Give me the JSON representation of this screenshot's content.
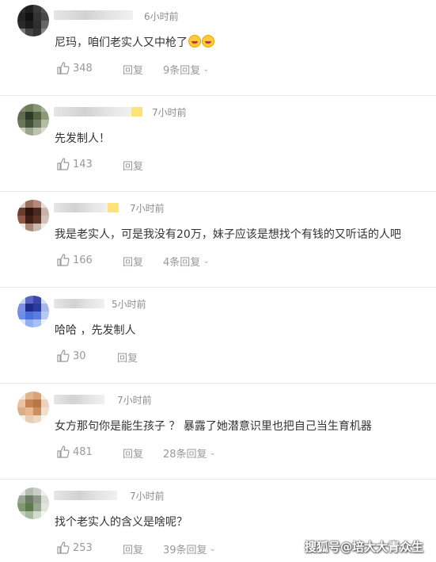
{
  "comments": [
    {
      "time": "6小时前",
      "text": "尼玛，咱们老实人又中枪了",
      "likes": "348",
      "reply": "回复",
      "more": "9条回复"
    },
    {
      "time": "7小时前",
      "text": "先发制人！",
      "likes": "143",
      "reply": "回复",
      "more": ""
    },
    {
      "time": "7小时前",
      "text": "我是老实人，可是我没有20万，妹子应该是想找个有钱的又听话的人吧",
      "likes": "166",
      "reply": "回复",
      "more": "4条回复"
    },
    {
      "time": "5小时前",
      "text": "哈哈 ，先发制人",
      "likes": "30",
      "reply": "回复",
      "more": ""
    },
    {
      "time": "7小时前",
      "text": "女方那句你是能生孩子 ？ 暴露了她潜意识里也把自己当生育机器",
      "likes": "481",
      "reply": "回复",
      "more": "28条回复"
    },
    {
      "time": "7小时前",
      "text": "找个老实人的含义是啥呢？",
      "likes": "253",
      "reply": "回复",
      "more": "39条回复"
    }
  ],
  "watermark": "搜狐号@培大大青众生",
  "icons": {
    "like": "thumbs-up-icon",
    "expand": "chevron-down-icon"
  },
  "colors": {
    "meta": "#999999",
    "text": "#333333",
    "divider": "#e8e8e8"
  }
}
